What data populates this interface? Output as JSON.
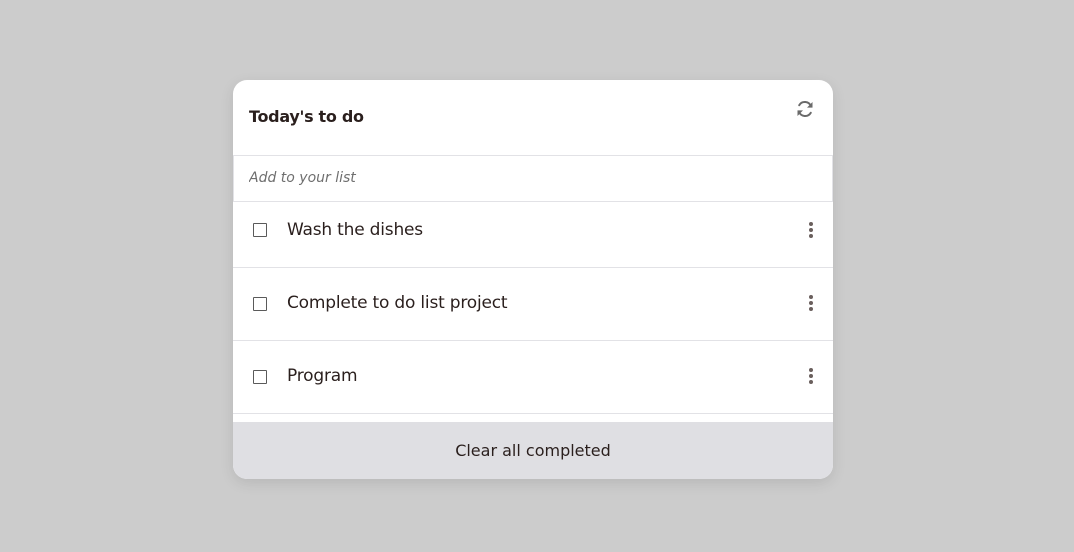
{
  "card": {
    "title": "Today's to do",
    "refresh_icon": "refresh-icon"
  },
  "input": {
    "placeholder": "Add to your list",
    "value": ""
  },
  "todos": [
    {
      "label": "Wash the dishes",
      "checked": false
    },
    {
      "label": "Complete to do list project",
      "checked": false
    },
    {
      "label": "Program",
      "checked": false
    }
  ],
  "footer": {
    "clear_label": "Clear all completed"
  },
  "colors": {
    "background": "#cccccc",
    "card": "#ffffff",
    "footer": "#dfdfe3",
    "text": "#2a1f1d"
  }
}
